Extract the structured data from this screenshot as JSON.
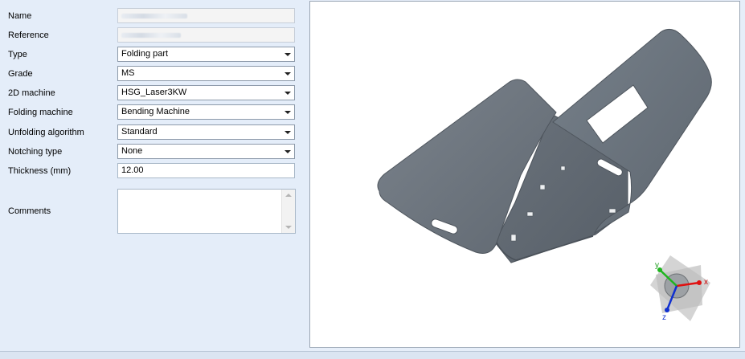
{
  "form": {
    "name": {
      "label": "Name",
      "value": ""
    },
    "reference": {
      "label": "Reference",
      "value": ""
    },
    "type": {
      "label": "Type",
      "value": "Folding part"
    },
    "grade": {
      "label": "Grade",
      "value": "MS"
    },
    "machine_2d": {
      "label": "2D machine",
      "value": "HSG_Laser3KW"
    },
    "folding_machine": {
      "label": "Folding machine",
      "value": "Bending Machine"
    },
    "unfolding_algorithm": {
      "label": "Unfolding algorithm",
      "value": "Standard"
    },
    "notching_type": {
      "label": "Notching type",
      "value": "None"
    },
    "thickness": {
      "label": "Thickness (mm)",
      "value": "12.00"
    },
    "comments": {
      "label": "Comments",
      "value": ""
    }
  },
  "viewport": {
    "axes": {
      "x": "x",
      "y": "y",
      "z": "z"
    },
    "colors": {
      "part": "#6f7780",
      "x_axis": "#e01010",
      "y_axis": "#1fb51f",
      "z_axis": "#1030d0"
    }
  }
}
